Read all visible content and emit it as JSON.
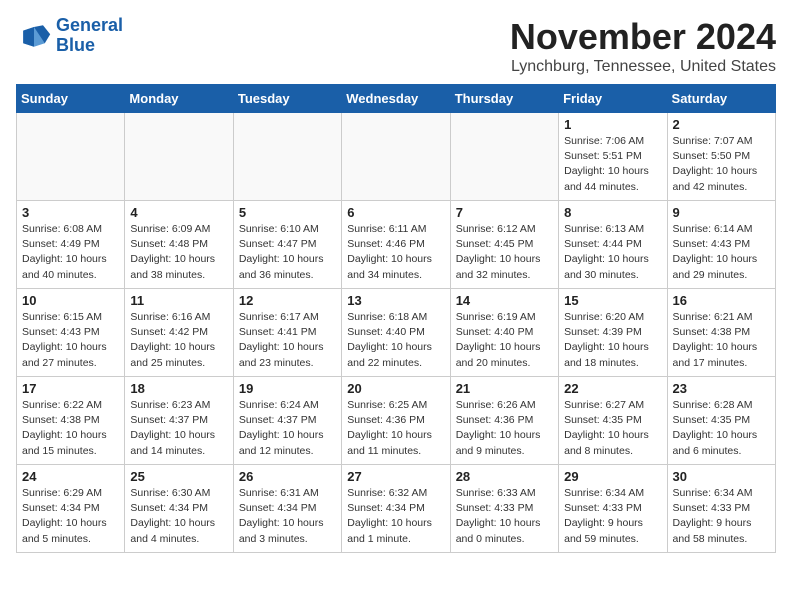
{
  "header": {
    "logo_line1": "General",
    "logo_line2": "Blue",
    "month": "November 2024",
    "location": "Lynchburg, Tennessee, United States"
  },
  "weekdays": [
    "Sunday",
    "Monday",
    "Tuesday",
    "Wednesday",
    "Thursday",
    "Friday",
    "Saturday"
  ],
  "weeks": [
    [
      {
        "day": "",
        "info": ""
      },
      {
        "day": "",
        "info": ""
      },
      {
        "day": "",
        "info": ""
      },
      {
        "day": "",
        "info": ""
      },
      {
        "day": "",
        "info": ""
      },
      {
        "day": "1",
        "info": "Sunrise: 7:06 AM\nSunset: 5:51 PM\nDaylight: 10 hours\nand 44 minutes."
      },
      {
        "day": "2",
        "info": "Sunrise: 7:07 AM\nSunset: 5:50 PM\nDaylight: 10 hours\nand 42 minutes."
      }
    ],
    [
      {
        "day": "3",
        "info": "Sunrise: 6:08 AM\nSunset: 4:49 PM\nDaylight: 10 hours\nand 40 minutes."
      },
      {
        "day": "4",
        "info": "Sunrise: 6:09 AM\nSunset: 4:48 PM\nDaylight: 10 hours\nand 38 minutes."
      },
      {
        "day": "5",
        "info": "Sunrise: 6:10 AM\nSunset: 4:47 PM\nDaylight: 10 hours\nand 36 minutes."
      },
      {
        "day": "6",
        "info": "Sunrise: 6:11 AM\nSunset: 4:46 PM\nDaylight: 10 hours\nand 34 minutes."
      },
      {
        "day": "7",
        "info": "Sunrise: 6:12 AM\nSunset: 4:45 PM\nDaylight: 10 hours\nand 32 minutes."
      },
      {
        "day": "8",
        "info": "Sunrise: 6:13 AM\nSunset: 4:44 PM\nDaylight: 10 hours\nand 30 minutes."
      },
      {
        "day": "9",
        "info": "Sunrise: 6:14 AM\nSunset: 4:43 PM\nDaylight: 10 hours\nand 29 minutes."
      }
    ],
    [
      {
        "day": "10",
        "info": "Sunrise: 6:15 AM\nSunset: 4:43 PM\nDaylight: 10 hours\nand 27 minutes."
      },
      {
        "day": "11",
        "info": "Sunrise: 6:16 AM\nSunset: 4:42 PM\nDaylight: 10 hours\nand 25 minutes."
      },
      {
        "day": "12",
        "info": "Sunrise: 6:17 AM\nSunset: 4:41 PM\nDaylight: 10 hours\nand 23 minutes."
      },
      {
        "day": "13",
        "info": "Sunrise: 6:18 AM\nSunset: 4:40 PM\nDaylight: 10 hours\nand 22 minutes."
      },
      {
        "day": "14",
        "info": "Sunrise: 6:19 AM\nSunset: 4:40 PM\nDaylight: 10 hours\nand 20 minutes."
      },
      {
        "day": "15",
        "info": "Sunrise: 6:20 AM\nSunset: 4:39 PM\nDaylight: 10 hours\nand 18 minutes."
      },
      {
        "day": "16",
        "info": "Sunrise: 6:21 AM\nSunset: 4:38 PM\nDaylight: 10 hours\nand 17 minutes."
      }
    ],
    [
      {
        "day": "17",
        "info": "Sunrise: 6:22 AM\nSunset: 4:38 PM\nDaylight: 10 hours\nand 15 minutes."
      },
      {
        "day": "18",
        "info": "Sunrise: 6:23 AM\nSunset: 4:37 PM\nDaylight: 10 hours\nand 14 minutes."
      },
      {
        "day": "19",
        "info": "Sunrise: 6:24 AM\nSunset: 4:37 PM\nDaylight: 10 hours\nand 12 minutes."
      },
      {
        "day": "20",
        "info": "Sunrise: 6:25 AM\nSunset: 4:36 PM\nDaylight: 10 hours\nand 11 minutes."
      },
      {
        "day": "21",
        "info": "Sunrise: 6:26 AM\nSunset: 4:36 PM\nDaylight: 10 hours\nand 9 minutes."
      },
      {
        "day": "22",
        "info": "Sunrise: 6:27 AM\nSunset: 4:35 PM\nDaylight: 10 hours\nand 8 minutes."
      },
      {
        "day": "23",
        "info": "Sunrise: 6:28 AM\nSunset: 4:35 PM\nDaylight: 10 hours\nand 6 minutes."
      }
    ],
    [
      {
        "day": "24",
        "info": "Sunrise: 6:29 AM\nSunset: 4:34 PM\nDaylight: 10 hours\nand 5 minutes."
      },
      {
        "day": "25",
        "info": "Sunrise: 6:30 AM\nSunset: 4:34 PM\nDaylight: 10 hours\nand 4 minutes."
      },
      {
        "day": "26",
        "info": "Sunrise: 6:31 AM\nSunset: 4:34 PM\nDaylight: 10 hours\nand 3 minutes."
      },
      {
        "day": "27",
        "info": "Sunrise: 6:32 AM\nSunset: 4:34 PM\nDaylight: 10 hours\nand 1 minute."
      },
      {
        "day": "28",
        "info": "Sunrise: 6:33 AM\nSunset: 4:33 PM\nDaylight: 10 hours\nand 0 minutes."
      },
      {
        "day": "29",
        "info": "Sunrise: 6:34 AM\nSunset: 4:33 PM\nDaylight: 9 hours\nand 59 minutes."
      },
      {
        "day": "30",
        "info": "Sunrise: 6:34 AM\nSunset: 4:33 PM\nDaylight: 9 hours\nand 58 minutes."
      }
    ]
  ]
}
